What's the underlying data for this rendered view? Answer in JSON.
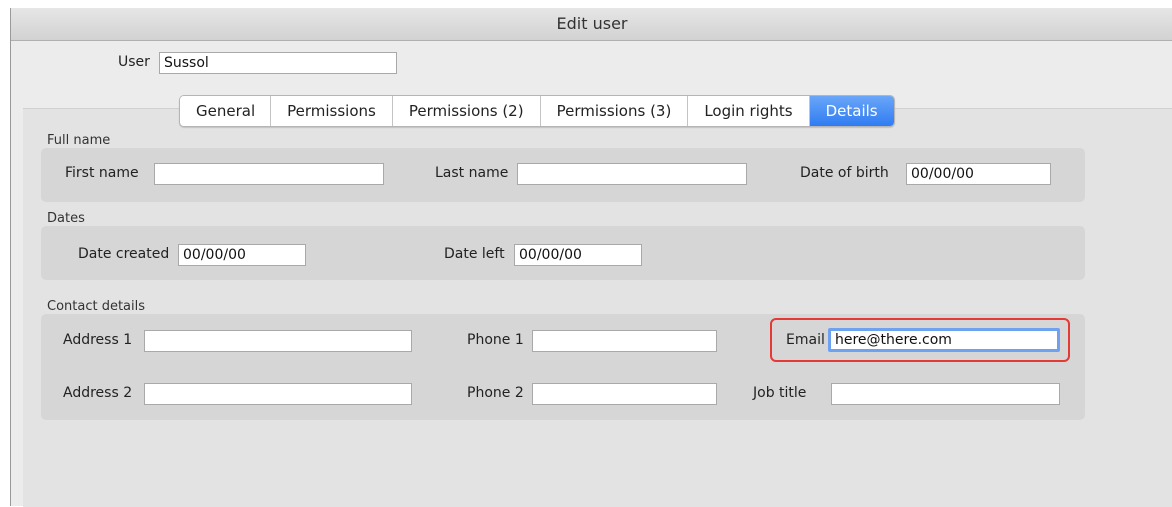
{
  "window": {
    "title": "Edit user"
  },
  "user": {
    "label": "User",
    "value": "Sussol"
  },
  "tabs": [
    {
      "label": "General",
      "active": false
    },
    {
      "label": "Permissions",
      "active": false
    },
    {
      "label": "Permissions (2)",
      "active": false
    },
    {
      "label": "Permissions (3)",
      "active": false
    },
    {
      "label": "Login rights",
      "active": false
    },
    {
      "label": "Details",
      "active": true
    }
  ],
  "full_name": {
    "group_label": "Full name",
    "first_name": {
      "label": "First name",
      "value": ""
    },
    "last_name": {
      "label": "Last name",
      "value": ""
    },
    "date_of_birth": {
      "label": "Date of birth",
      "value": "00/00/00"
    }
  },
  "dates": {
    "group_label": "Dates",
    "date_created": {
      "label": "Date created",
      "value": "00/00/00"
    },
    "date_left": {
      "label": "Date left",
      "value": "00/00/00"
    }
  },
  "contact": {
    "group_label": "Contact details",
    "address1": {
      "label": "Address 1",
      "value": ""
    },
    "address2": {
      "label": "Address 2",
      "value": ""
    },
    "phone1": {
      "label": "Phone 1",
      "value": ""
    },
    "phone2": {
      "label": "Phone 2",
      "value": ""
    },
    "email": {
      "label": "Email",
      "value": "here@there.com"
    },
    "job_title": {
      "label": "Job title",
      "value": ""
    }
  },
  "colors": {
    "active_tab": "#2f7cf2",
    "highlight": "#e53935",
    "focus_ring": "#6ea2f0"
  }
}
